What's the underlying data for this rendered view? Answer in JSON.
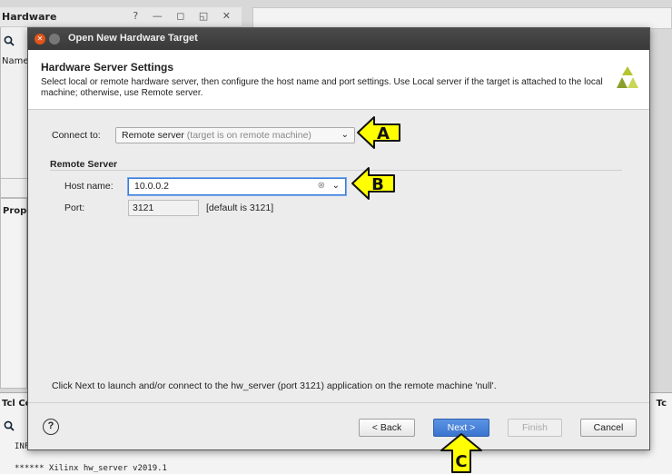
{
  "background": {
    "hardware_panel_title": "Hardware",
    "hardware_panel_controls": "? — ◻ ◱ ✕",
    "hardware_name_column": "Name",
    "properties_panel_title": "Prope",
    "tcl_panel_title": "Tcl Co",
    "tcl_right_label": "Tc",
    "tcl_line1": "INF",
    "tcl_line2": "****** Xilinx hw_server v2019.1"
  },
  "dialog": {
    "title": "Open New Hardware Target",
    "header_title": "Hardware Server Settings",
    "header_description": "Select local or remote hardware server, then configure the host name and port settings. Use Local server if the target is attached to the local machine; otherwise, use Remote server.",
    "connect_to_label": "Connect to:",
    "connect_to_value": "Remote server",
    "connect_to_hint": " (target is on remote machine)",
    "section_title": "Remote Server",
    "host_name_label": "Host name:",
    "host_name_value": "10.0.0.2",
    "port_label": "Port:",
    "port_value": "3121",
    "port_hint": "[default is 3121]",
    "footnote": "Click Next to launch and/or connect to the hw_server (port 3121) application on the remote machine 'null'.",
    "buttons": {
      "help": "?",
      "back": "< Back",
      "next": "Next >",
      "finish": "Finish",
      "cancel": "Cancel"
    }
  },
  "annotations": {
    "a": "A",
    "b": "B",
    "c": "C",
    "arrow_color": "#ffff00"
  },
  "colors": {
    "accent": "#3a74cf",
    "close_button": "#e2541a"
  }
}
